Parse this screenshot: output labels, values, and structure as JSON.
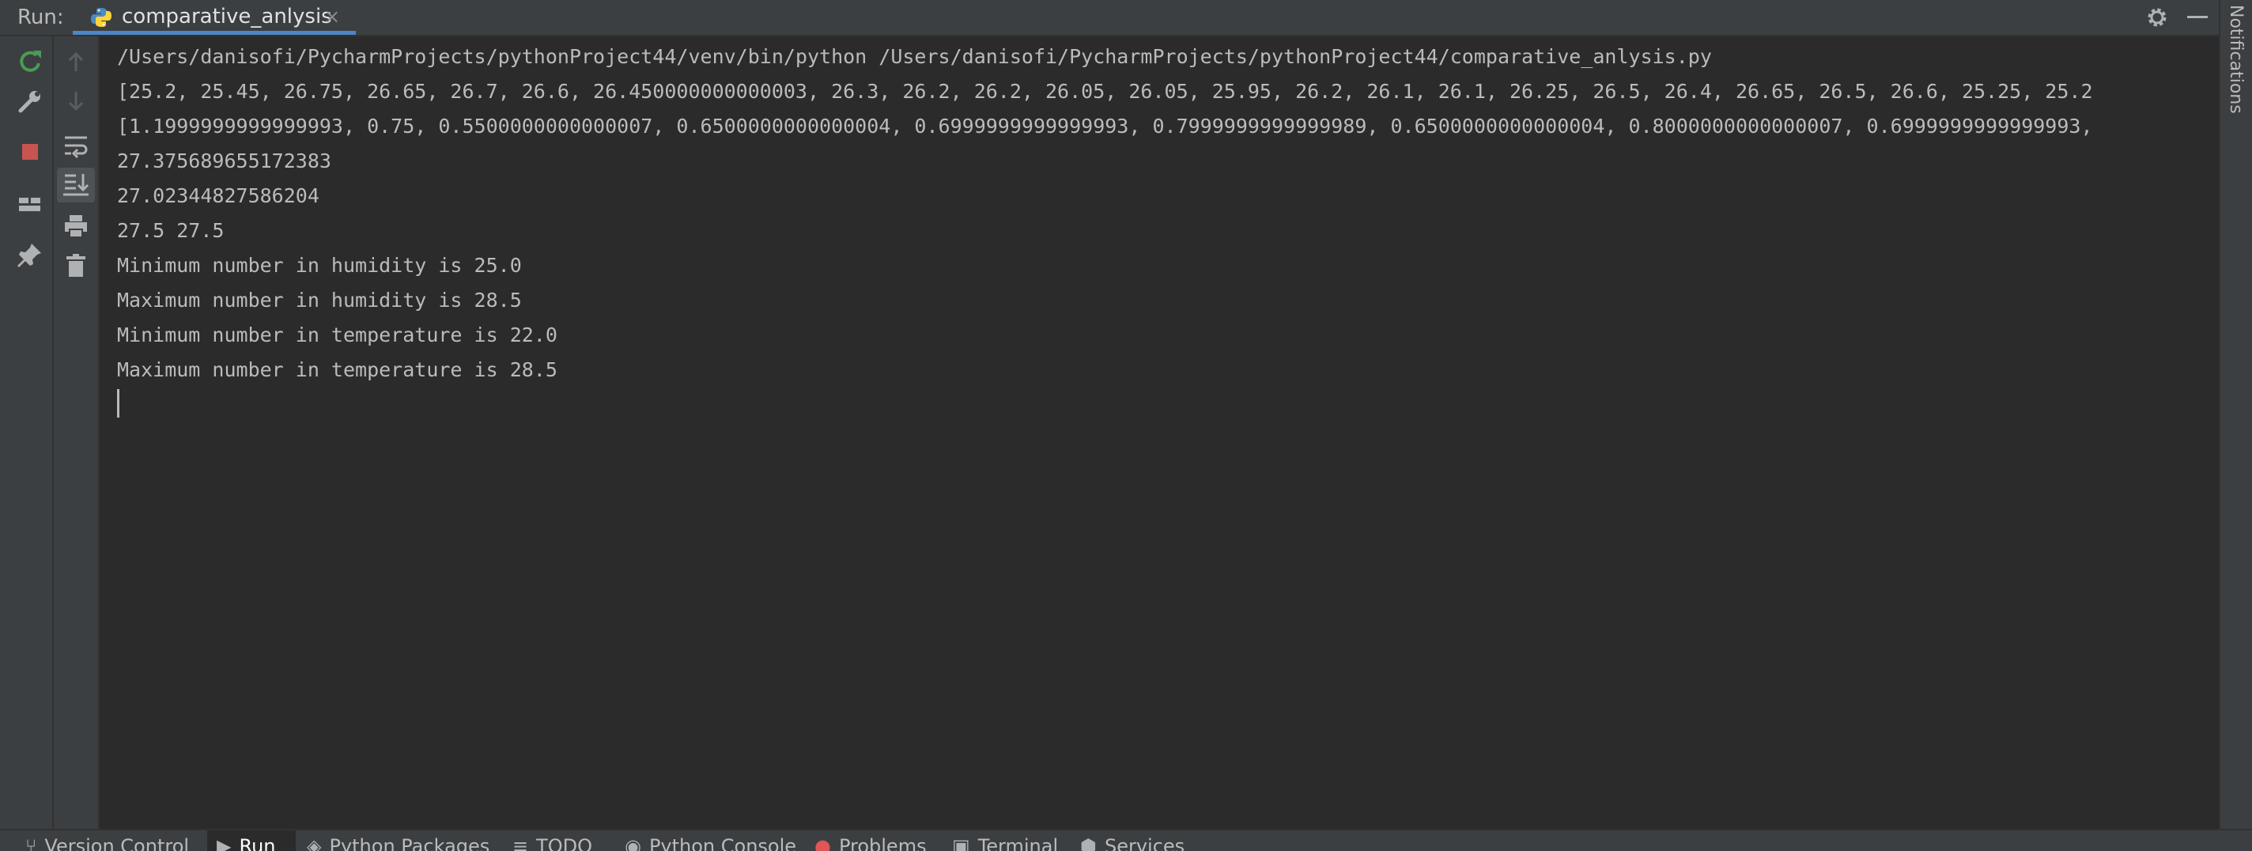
{
  "header": {
    "run_label": "Run:",
    "tab_label": "comparative_anlysis",
    "tab_close": "×",
    "icons": [
      "python-file-icon",
      "gear-icon",
      "minimize-icon"
    ]
  },
  "notifications_label": "Notifications",
  "toolbar": {
    "icons": [
      "rerun-icon",
      "wrench-icon",
      "stop-icon",
      "layout-icon",
      "pin-icon",
      "up-arrow-icon",
      "down-arrow-icon",
      "soft-wrap-icon",
      "scroll-to-end-icon",
      "print-icon",
      "trash-icon"
    ]
  },
  "console": {
    "lines": [
      "/Users/danisofi/PycharmProjects/pythonProject44/venv/bin/python /Users/danisofi/PycharmProjects/pythonProject44/comparative_anlysis.py",
      "[25.2, 25.45, 26.75, 26.65, 26.7, 26.6, 26.450000000000003, 26.3, 26.2, 26.2, 26.05, 26.05, 25.95, 26.2, 26.1, 26.1, 26.25, 26.5, 26.4, 26.65, 26.5, 26.6, 25.25, 25.2",
      "[1.1999999999999993, 0.75, 0.5500000000000007, 0.6500000000000004, 0.6999999999999993, 0.7999999999999989, 0.6500000000000004, 0.8000000000000007, 0.6999999999999993,",
      "27.375689655172383",
      "27.02344827586204",
      "27.5 27.5",
      "Minimum number in humidity is 25.0",
      "Maximum number in humidity is 28.5",
      "Minimum number in temperature is 22.0",
      "Maximum number in temperature is 28.5"
    ]
  },
  "bottom_tabs": {
    "version_control": "Version Control",
    "run": "Run",
    "python_packages": "Python Packages",
    "todo": "TODO",
    "python_console": "Python Console",
    "problems": "Problems",
    "terminal": "Terminal",
    "services": "Services"
  },
  "colors": {
    "background": "#2b2b2b",
    "panel": "#3c3f41",
    "text": "#bbbbbb",
    "accent": "#4a88c7",
    "rerun": "#499c54",
    "stop": "#c75450",
    "problems": "#e05555"
  }
}
